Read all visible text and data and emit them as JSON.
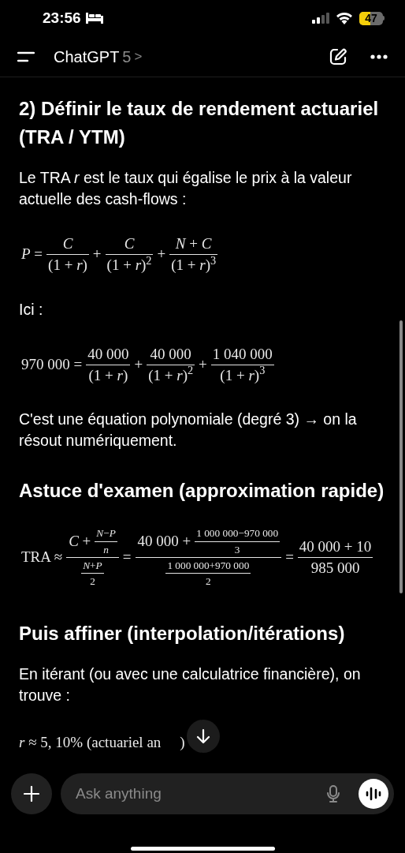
{
  "status_bar": {
    "time": "23:56",
    "battery": "47"
  },
  "header": {
    "title": "ChatGPT",
    "model": "5",
    "chevron": ">"
  },
  "blocks": [
    {
      "kind": "heading",
      "text": "2) Définir le taux de rendement actuariel (TRA / YTM)"
    },
    {
      "kind": "paragraph",
      "text": "Le TRA *r* est le taux qui égalise le prix à la valeur actuelle des cash-flows :"
    },
    {
      "kind": "formula",
      "parts": [
        "*P* =",
        {
          "num": "*C*",
          "den": "(1 + *r*)"
        },
        "+",
        {
          "num": "*C*",
          "den": "(1 + *r*)$^{2}$"
        },
        "+",
        {
          "num": "*N* + *C*",
          "den": "(1 + *r*)$^{3}$"
        }
      ]
    },
    {
      "kind": "paragraph",
      "text": "Ici :"
    },
    {
      "kind": "formula",
      "parts": [
        "970 000 =",
        {
          "num": "40 000",
          "den": "(1 + *r*)"
        },
        "+",
        {
          "num": "40 000",
          "den": "(1 + *r*)$^{2}$"
        },
        "+",
        {
          "num": "1 040 000",
          "den": "(1 + *r*)$^{3}$"
        }
      ]
    },
    {
      "kind": "paragraph",
      "text": "C'est une équation polynomiale (degré 3) → on la résout numériquement."
    },
    {
      "kind": "heading",
      "text": "Astuce d'examen (approximation rapide)"
    },
    {
      "kind": "formula",
      "parts": [
        "TRA ≈",
        {
          "num": [
            "*C* +",
            {
              "num": "*N*−*P*",
              "den": "*n*"
            }
          ],
          "den": [
            {
              "num": "*N*+*P*",
              "den": "2"
            }
          ]
        },
        "=",
        {
          "num": [
            "40 000 +",
            {
              "num": "1 000 000−970 000",
              "den": "3"
            }
          ],
          "den": [
            {
              "num": "1 000 000+970 000",
              "den": "2"
            }
          ]
        },
        "=",
        {
          "num": "40 000 + 10",
          "den": "985 000"
        }
      ]
    },
    {
      "kind": "heading",
      "text": "Puis affiner (interpolation/itérations)"
    },
    {
      "kind": "paragraph",
      "text": "En itérant (ou avec une calculatrice financière), on trouve :"
    },
    {
      "kind": "result",
      "parts": [
        "*r* ≈ 5, 10% (actuariel an",
        ")"
      ]
    }
  ],
  "composer": {
    "placeholder": "Ask anything"
  }
}
